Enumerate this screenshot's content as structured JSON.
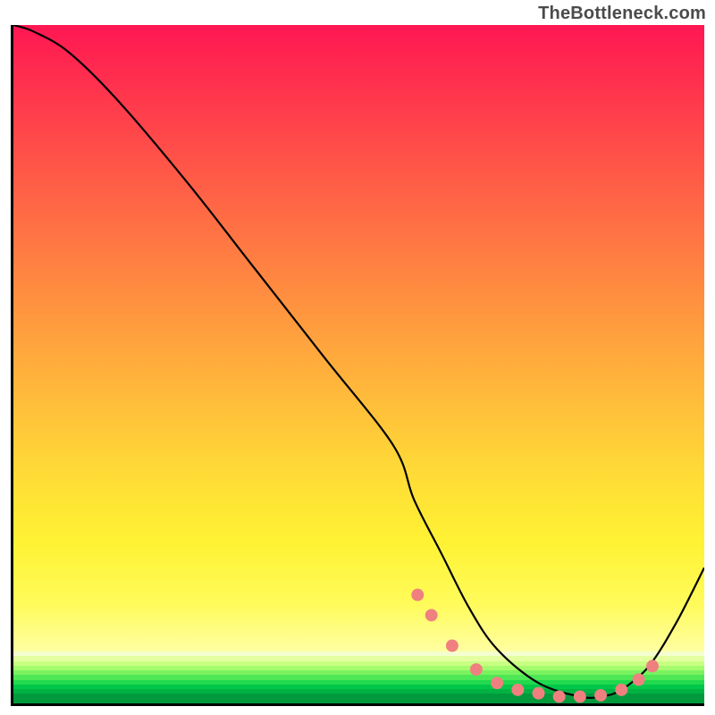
{
  "watermark": {
    "text": "TheBottleneck.com"
  },
  "chart_data": {
    "type": "line",
    "title": "",
    "xlabel": "",
    "ylabel": "",
    "xlim": [
      0,
      100
    ],
    "ylim": [
      0,
      100
    ],
    "grid": false,
    "legend": false,
    "series": [
      {
        "name": "bottleneck-curve",
        "x": [
          0,
          3,
          8,
          15,
          25,
          35,
          45,
          55,
          58,
          62,
          66,
          70,
          76,
          82,
          85,
          88,
          92,
          96,
          100
        ],
        "values": [
          100,
          99,
          96,
          89,
          77,
          64,
          51,
          38,
          30,
          22,
          14,
          8,
          3,
          1,
          1,
          2,
          5.5,
          12,
          20
        ]
      }
    ],
    "markers": {
      "name": "highlight-dots",
      "color": "#f08080",
      "x": [
        58.5,
        60.5,
        63.5,
        67,
        70,
        73,
        76,
        79,
        82,
        85,
        88,
        90.5,
        92.5
      ],
      "values": [
        16,
        13,
        8.5,
        5,
        3,
        2,
        1.5,
        1,
        1,
        1.2,
        2,
        3.5,
        5.5
      ]
    },
    "background_gradient": {
      "top": "#ff1752",
      "mid": "#ffd837",
      "bottom_band": [
        "#e3ffa0",
        "#bfff7a",
        "#8cf763",
        "#4eea55",
        "#18d94c",
        "#00c247",
        "#00a840",
        "#009038"
      ]
    }
  }
}
